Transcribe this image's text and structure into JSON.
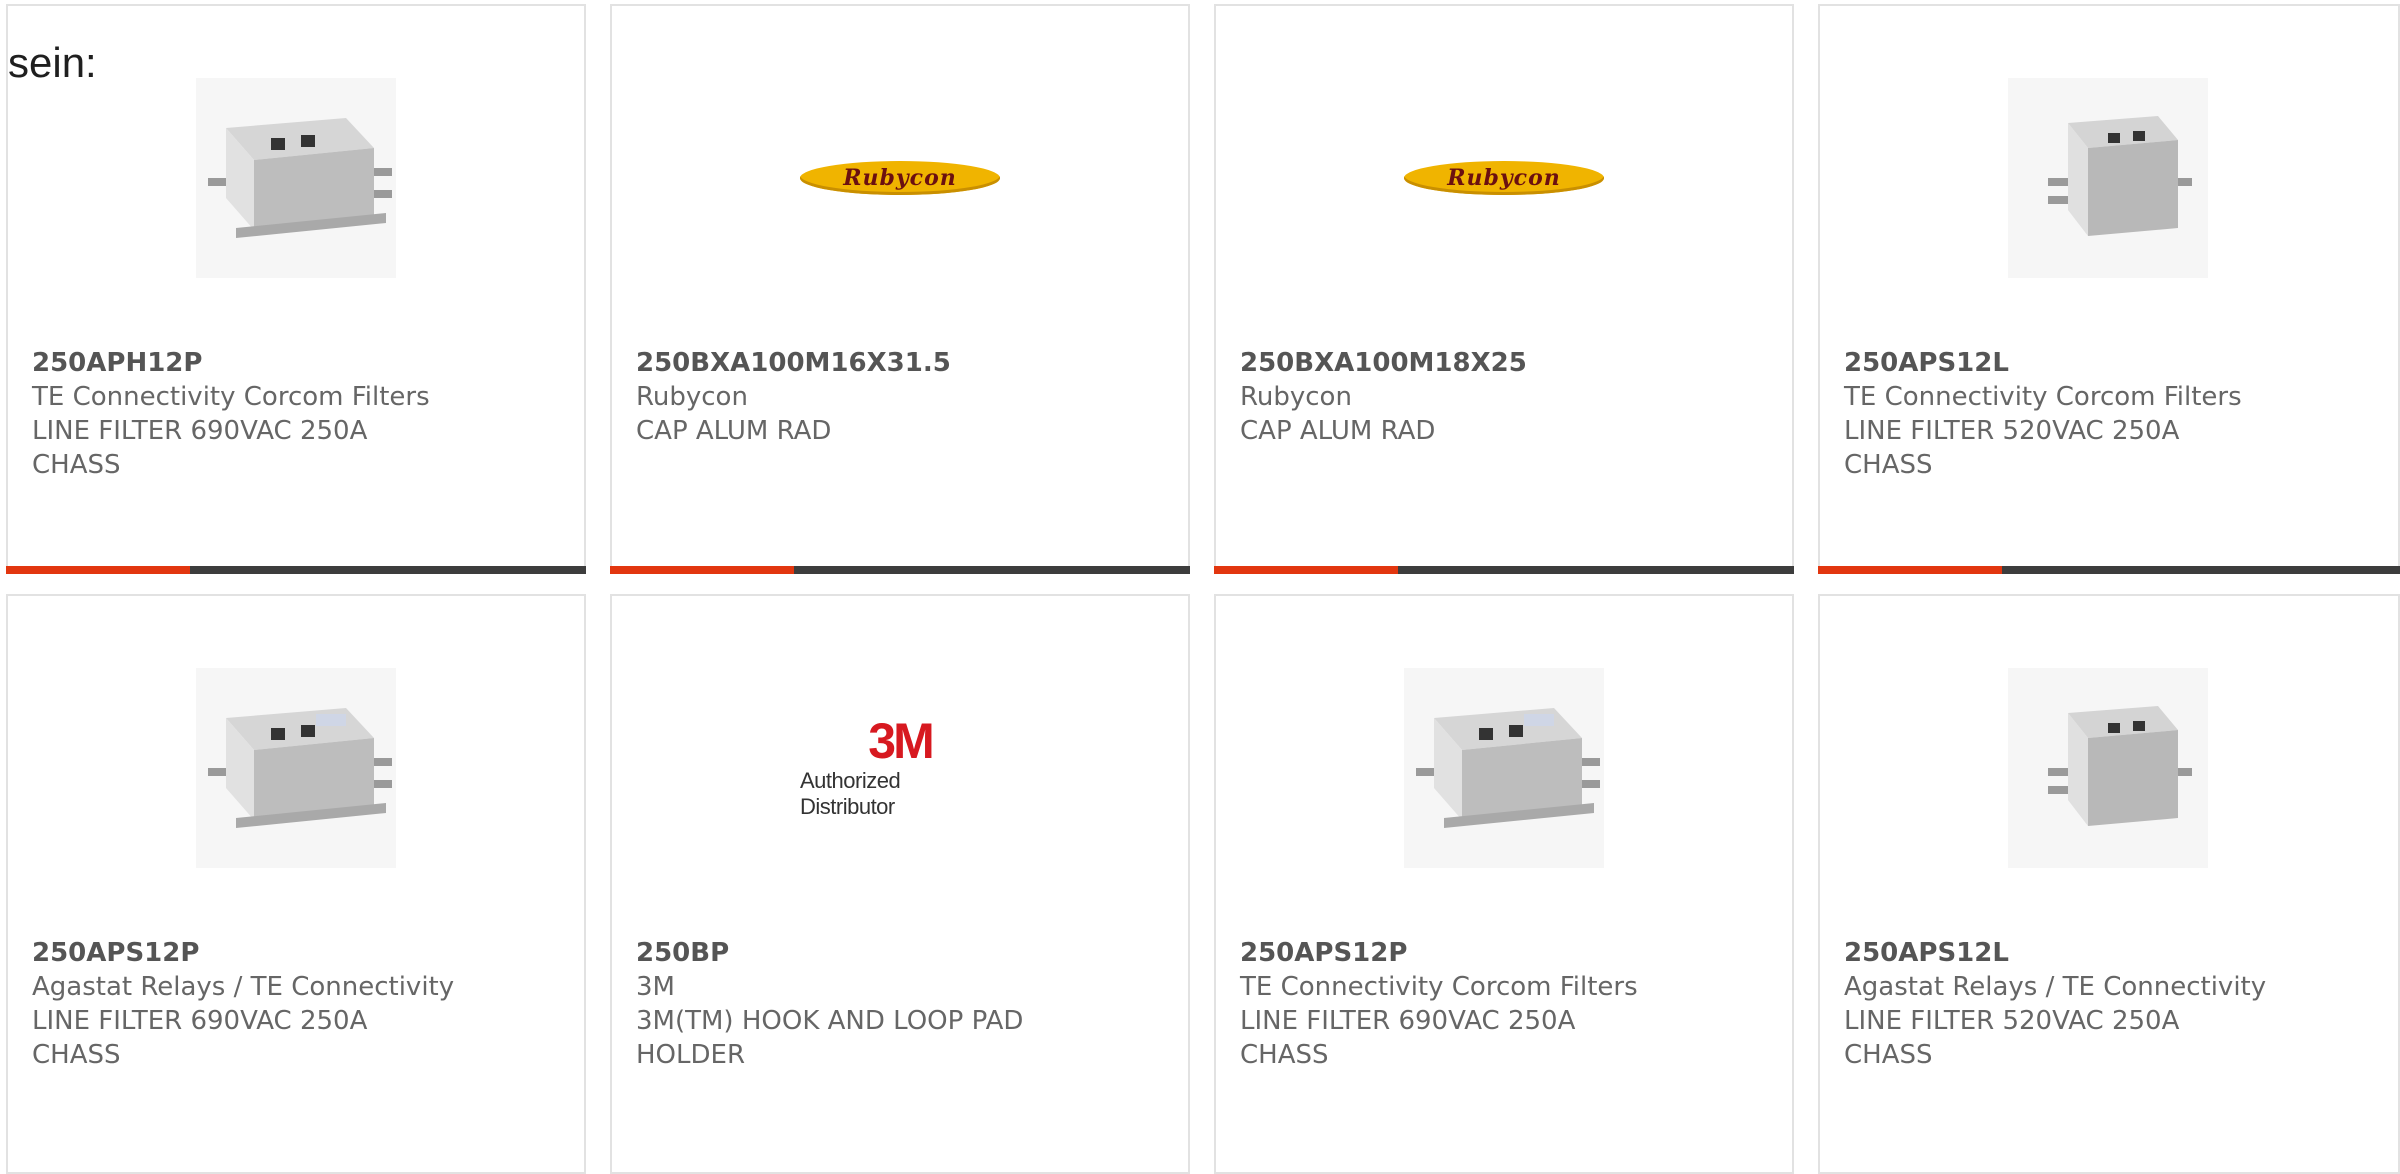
{
  "intro_text": "sein:",
  "products": [
    {
      "part": "250APH12P",
      "maker": "TE Connectivity Corcom Filters",
      "desc1": "LINE FILTER 690VAC 250A",
      "desc2": "CHASS",
      "image": "line-filter"
    },
    {
      "part": "250BXA100M16X31.5",
      "maker": "Rubycon",
      "desc1": "CAP ALUM RAD",
      "desc2": "",
      "image": "rubycon-logo",
      "logo_text": "Rubycon"
    },
    {
      "part": "250BXA100M18X25",
      "maker": "Rubycon",
      "desc1": "CAP ALUM RAD",
      "desc2": "",
      "image": "rubycon-logo",
      "logo_text": "Rubycon"
    },
    {
      "part": "250APS12L",
      "maker": "TE Connectivity Corcom Filters",
      "desc1": "LINE FILTER 520VAC 250A",
      "desc2": "CHASS",
      "image": "line-filter"
    },
    {
      "part": "250APS12P",
      "maker": "Agastat Relays / TE Connectivity",
      "desc1": "LINE FILTER 690VAC 250A",
      "desc2": "CHASS",
      "image": "line-filter"
    },
    {
      "part": "250BP",
      "maker": "3M",
      "desc1": "3M(TM) HOOK AND LOOP PAD",
      "desc2": "HOLDER",
      "image": "3m-logo",
      "logo_text": "3M",
      "logo_subtext": "Authorized Distributor"
    },
    {
      "part": "250APS12P",
      "maker": "TE Connectivity Corcom Filters",
      "desc1": "LINE FILTER 690VAC 250A",
      "desc2": "CHASS",
      "image": "line-filter"
    },
    {
      "part": "250APS12L",
      "maker": "Agastat Relays / TE Connectivity",
      "desc1": "LINE FILTER 520VAC 250A",
      "desc2": "CHASS",
      "image": "line-filter"
    }
  ],
  "colors": {
    "accent": "#e2360f",
    "bar": "#3d3d3d",
    "border": "#e2e2e2",
    "text": "#666666"
  }
}
